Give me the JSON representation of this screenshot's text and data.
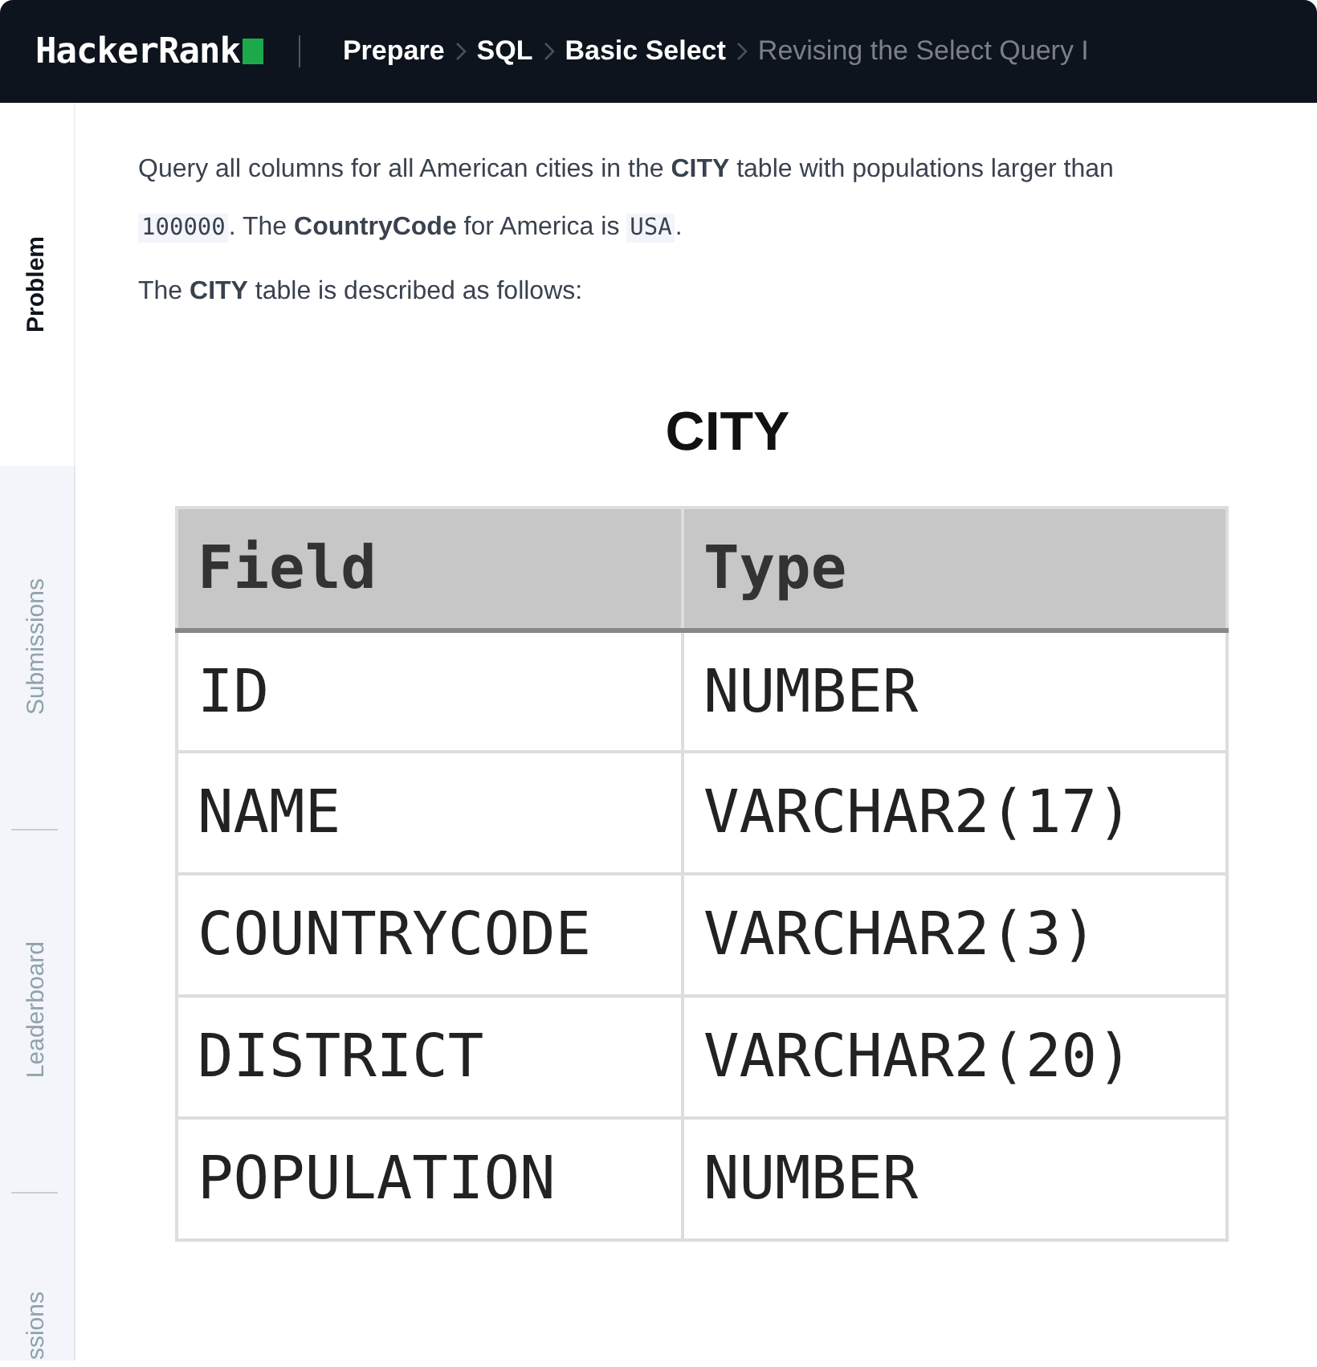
{
  "header": {
    "logo": "HackerRank",
    "breadcrumbs": [
      {
        "label": "Prepare",
        "current": false
      },
      {
        "label": "SQL",
        "current": false
      },
      {
        "label": "Basic Select",
        "current": false
      },
      {
        "label": "Revising the Select Query I",
        "current": true
      }
    ]
  },
  "side_tabs": [
    {
      "label": "Problem",
      "selected": true
    },
    {
      "label": "Submissions",
      "selected": false
    },
    {
      "label": "Leaderboard",
      "selected": false
    },
    {
      "label": "ssions",
      "selected": false
    }
  ],
  "problem": {
    "paragraphs": [
      [
        {
          "kind": "text",
          "text": "Query all columns for all American cities in the **CITY** table with populations larger than "
        },
        {
          "kind": "code",
          "text": "100000"
        },
        {
          "kind": "text",
          "text": ". The **CountryCode** for America is "
        },
        {
          "kind": "code",
          "text": "USA"
        },
        {
          "kind": "text",
          "text": "."
        }
      ],
      [
        {
          "kind": "text",
          "text": "The **CITY** table is described as follows:"
        }
      ]
    ],
    "table_image": {
      "title": "CITY",
      "columns": [
        "Field",
        "Type"
      ],
      "rows": [
        [
          "ID",
          "NUMBER"
        ],
        [
          "NAME",
          "VARCHAR2(17)"
        ],
        [
          "COUNTRYCODE",
          "VARCHAR2(3)"
        ],
        [
          "DISTRICT",
          "VARCHAR2(20)"
        ],
        [
          "POPULATION",
          "NUMBER"
        ]
      ]
    }
  }
}
